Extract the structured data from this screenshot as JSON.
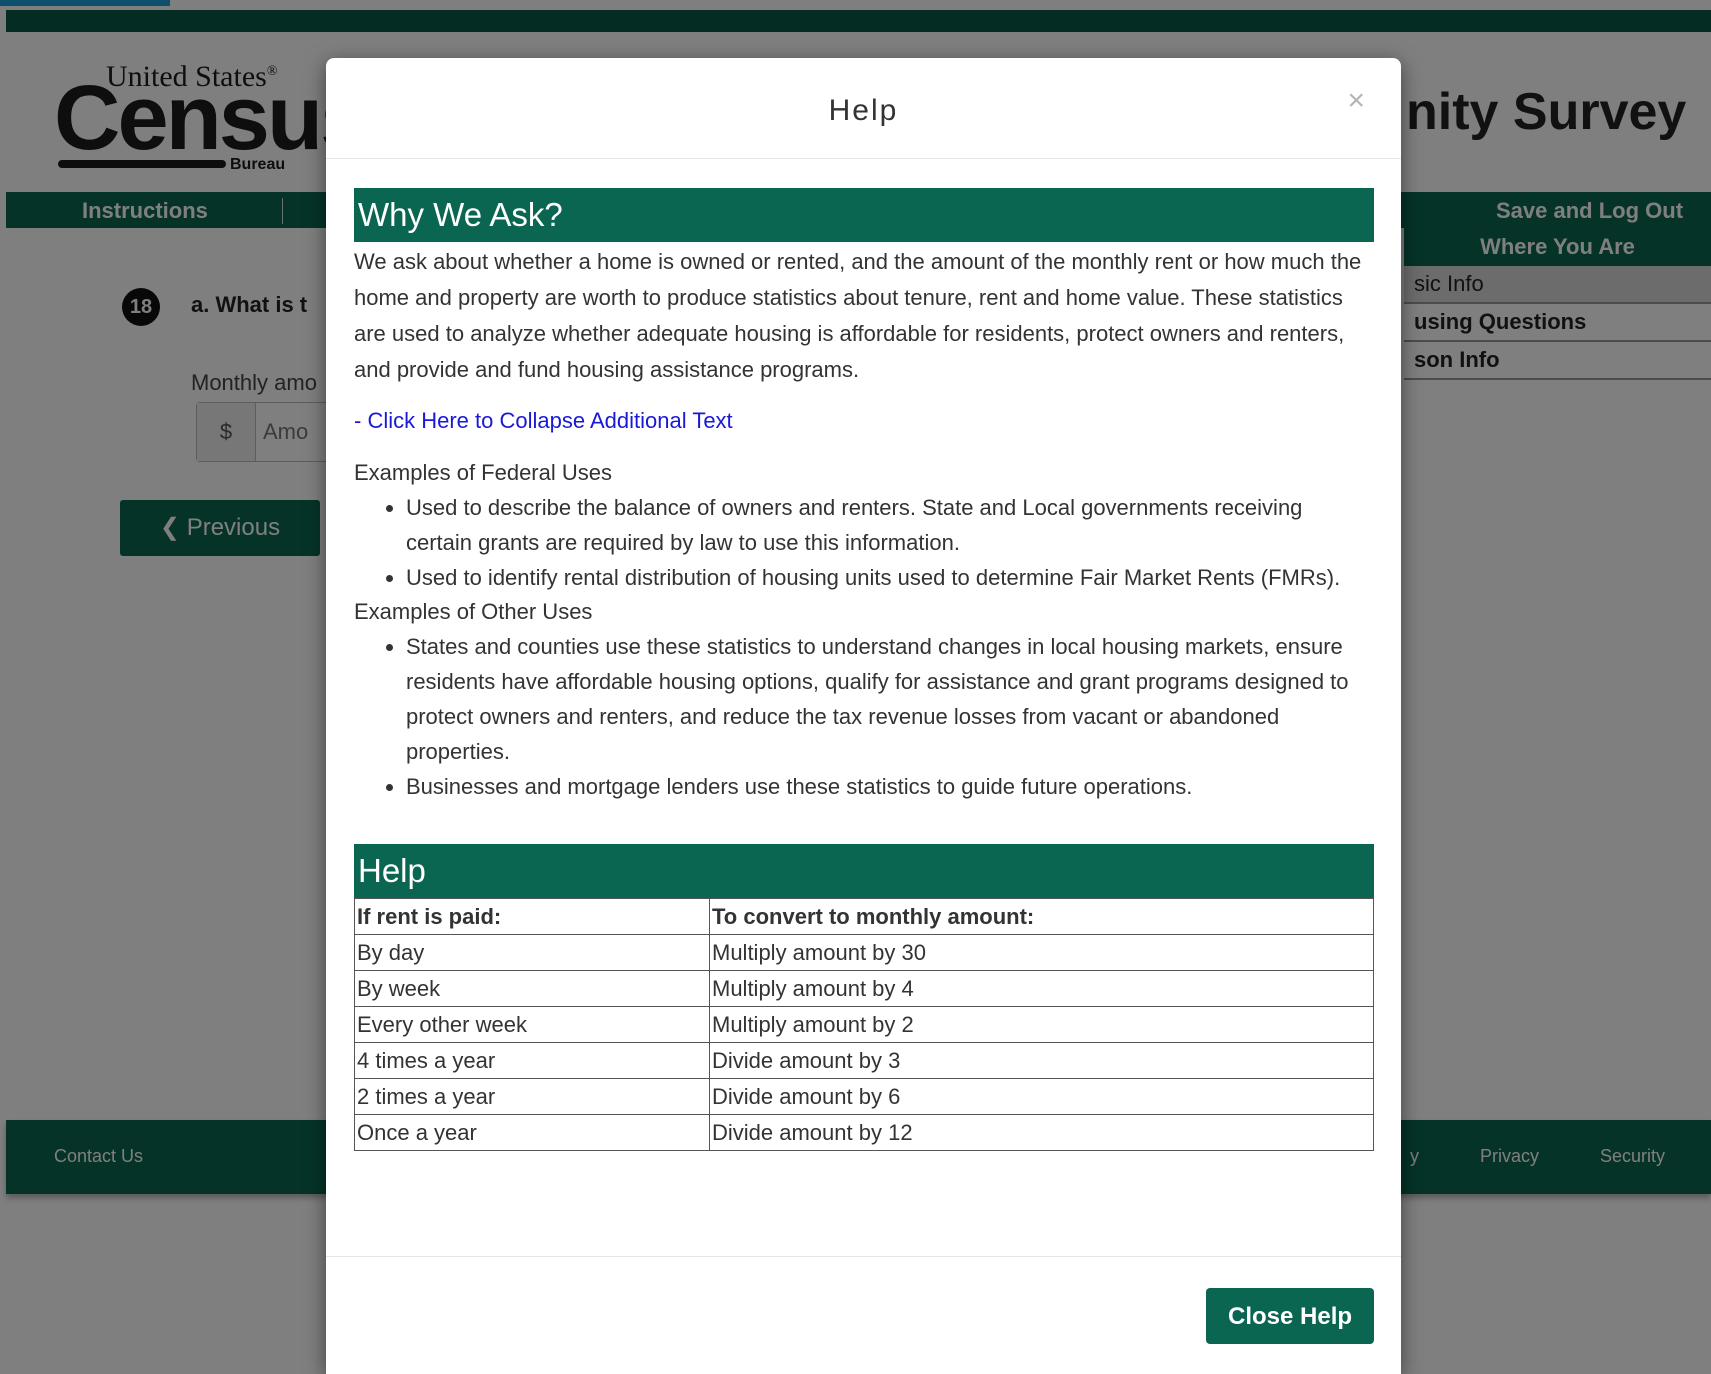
{
  "header": {
    "logo_united_states": "United States",
    "logo_census": "Census",
    "logo_bureau": "Bureau",
    "survey_title": "nity Survey"
  },
  "nav": {
    "instructions": "Instructions",
    "save_log_out": "Save and Log Out"
  },
  "where_you_are": {
    "title": "Where You Are",
    "items": [
      "sic Info",
      "using Questions",
      "son Info"
    ]
  },
  "question": {
    "number": "18",
    "text": "a. What is t",
    "monthly_label": "Monthly amo",
    "currency": "$",
    "amount_placeholder": "Amo"
  },
  "buttons": {
    "previous": "Previous",
    "close_help": "Close Help"
  },
  "footer": {
    "contact": "Contact Us",
    "partial": "y",
    "privacy": "Privacy",
    "security": "Security"
  },
  "modal": {
    "title": "Help",
    "close_symbol": "×",
    "why_title": "Why We Ask?",
    "why_text": "We ask about whether a home is owned or rented, and the amount of the monthly rent or how much the home and property are worth to produce statistics about tenure, rent and home value. These statistics are used to analyze whether adequate housing is affordable for residents, protect owners and renters, and provide and fund housing assistance programs.",
    "collapse_link": "- Click Here to Collapse Additional Text",
    "federal_heading": "Examples of Federal Uses",
    "federal_uses": [
      "Used to describe the balance of owners and renters. State and Local governments receiving certain grants are required by law to use this information.",
      "Used to identify rental distribution of housing units used to determine Fair Market Rents (FMRs)."
    ],
    "other_heading": "Examples of Other Uses",
    "other_uses": [
      "States and counties use these statistics to understand changes in local housing markets, ensure residents have affordable housing options, qualify for assistance and grant programs designed to protect owners and renters, and reduce the tax revenue losses from vacant or abandoned properties.",
      "Businesses and mortgage lenders use these statistics to guide future operations."
    ],
    "help_title": "Help",
    "table": {
      "headers": [
        "If rent is paid:",
        "To convert to monthly amount:"
      ],
      "rows": [
        [
          "By day",
          "Multiply amount by 30"
        ],
        [
          "By week",
          "Multiply amount by 4"
        ],
        [
          "Every other week",
          "Multiply amount by 2"
        ],
        [
          "4 times a year",
          "Divide amount by 3"
        ],
        [
          "2 times a year",
          "Divide amount by 6"
        ],
        [
          "Once a year",
          "Divide amount by 12"
        ]
      ]
    }
  }
}
